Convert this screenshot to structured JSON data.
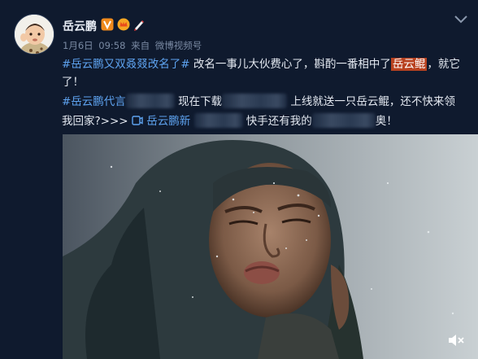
{
  "author": {
    "name": "岳云鹏",
    "avatar_icon": "baby-avatar-icon",
    "badges": [
      "verified-v-icon",
      "vip-crown-icon",
      "pen-icon"
    ]
  },
  "meta": {
    "date": "1月6日",
    "time": "09:58",
    "from": "来自",
    "source": "微博视频号"
  },
  "post": {
    "topic1": "#岳云鹏又双叒叕改名了#",
    "line1_text": "改名一事儿大伙费心了，斟酌一番相中了",
    "highlight": "岳云鲲",
    "line1_tail": "，就它",
    "line2": "了！",
    "topic2": "#岳云鹏代言",
    "line3_a": "现在下载",
    "line3_b": "上线就送一只岳云鲲，还不快来领",
    "line4_a": "我回家?>>>",
    "link_text": "岳云鹏新",
    "line4_b": "快手还有我的",
    "line4_c": "奥！"
  },
  "media": {
    "type": "video",
    "mute_icon": "speaker-mute-icon"
  },
  "colors": {
    "background": "#0f1a2e",
    "link": "#5ea3f0",
    "highlight": "#b8411f"
  }
}
